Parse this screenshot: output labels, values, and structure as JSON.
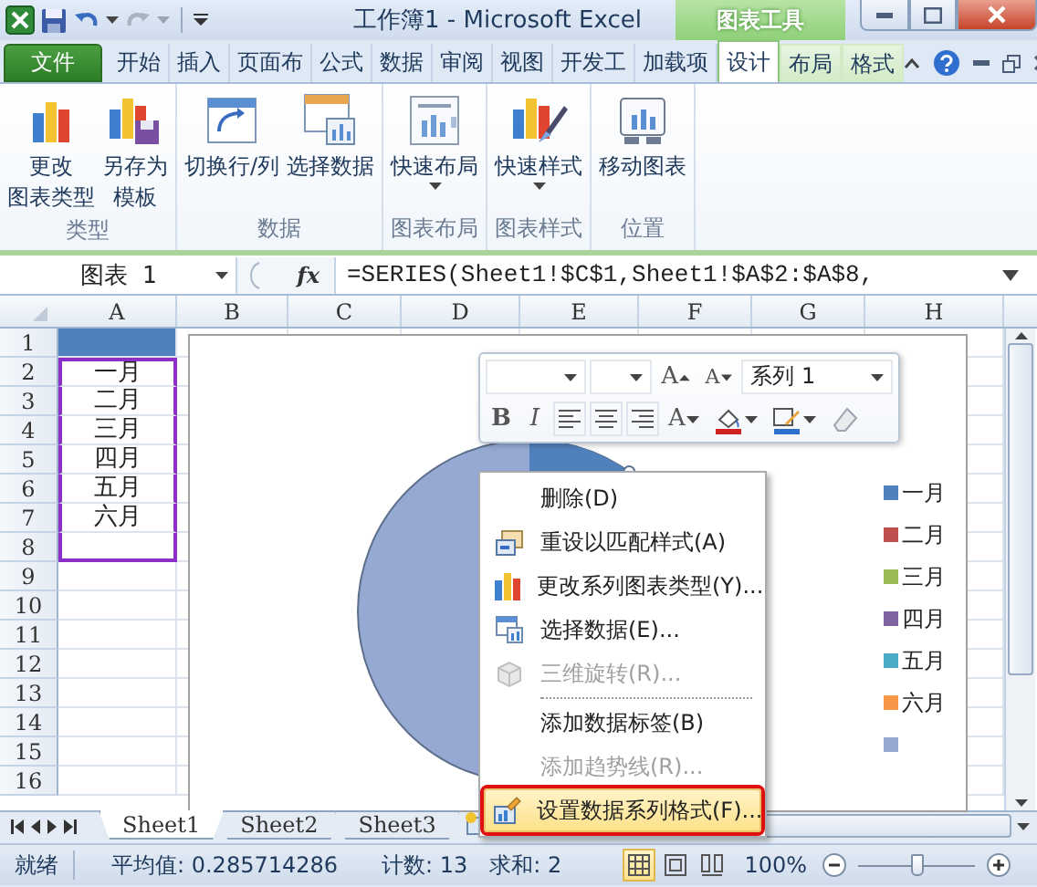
{
  "window": {
    "title": "工作簿1 - Microsoft Excel",
    "tool_group": "图表工具"
  },
  "ribbon_tabs": [
    {
      "label": "文件",
      "kind": "file",
      "selected": false
    },
    {
      "label": "开始",
      "kind": "normal",
      "selected": false
    },
    {
      "label": "插入",
      "kind": "normal",
      "selected": false
    },
    {
      "label": "页面布",
      "kind": "normal",
      "selected": false
    },
    {
      "label": "公式",
      "kind": "normal",
      "selected": false
    },
    {
      "label": "数据",
      "kind": "normal",
      "selected": false
    },
    {
      "label": "审阅",
      "kind": "normal",
      "selected": false
    },
    {
      "label": "视图",
      "kind": "normal",
      "selected": false
    },
    {
      "label": "开发工",
      "kind": "normal",
      "selected": false
    },
    {
      "label": "加载项",
      "kind": "normal",
      "selected": false
    },
    {
      "label": "设计",
      "kind": "context",
      "selected": true
    },
    {
      "label": "布局",
      "kind": "context",
      "selected": false
    },
    {
      "label": "格式",
      "kind": "context",
      "selected": false
    }
  ],
  "ribbon_groups": [
    {
      "label": "类型",
      "buttons": [
        {
          "lines": [
            "更改",
            "图表类型"
          ],
          "dropdown": false
        },
        {
          "lines": [
            "另存为",
            "模板"
          ],
          "dropdown": false
        }
      ]
    },
    {
      "label": "数据",
      "buttons": [
        {
          "lines": [
            "切换行/列"
          ],
          "dropdown": false
        },
        {
          "lines": [
            "选择数据"
          ],
          "dropdown": false
        }
      ]
    },
    {
      "label": "图表布局",
      "buttons": [
        {
          "lines": [
            "快速布局"
          ],
          "dropdown": true
        }
      ]
    },
    {
      "label": "图表样式",
      "buttons": [
        {
          "lines": [
            "快速样式"
          ],
          "dropdown": true
        }
      ]
    },
    {
      "label": "位置",
      "buttons": [
        {
          "lines": [
            "移动图表"
          ],
          "dropdown": false
        }
      ]
    }
  ],
  "formula_bar": {
    "name_box": "图表 1",
    "function_label": "fx",
    "formula": "=SERIES(Sheet1!$C$1,Sheet1!$A$2:$A$8,"
  },
  "columns": [
    "A",
    "B",
    "C",
    "D",
    "E",
    "F",
    "G",
    "H"
  ],
  "rows": [
    {
      "number": "1",
      "highlighted": true,
      "in_range": false
    },
    {
      "number": "2",
      "a": "一月",
      "highlighted": false,
      "in_range": true
    },
    {
      "number": "3",
      "a": "二月",
      "highlighted": false,
      "in_range": true
    },
    {
      "number": "4",
      "a": "三月",
      "highlighted": false,
      "in_range": true
    },
    {
      "number": "5",
      "a": "四月",
      "highlighted": false,
      "in_range": true
    },
    {
      "number": "6",
      "a": "五月",
      "highlighted": false,
      "in_range": true
    },
    {
      "number": "7",
      "a": "六月",
      "highlighted": false,
      "in_range": true
    },
    {
      "number": "8",
      "highlighted": false,
      "in_range": true
    },
    {
      "number": "9",
      "highlighted": false,
      "in_range": false
    },
    {
      "number": "10",
      "highlighted": false,
      "in_range": false
    },
    {
      "number": "11",
      "highlighted": false,
      "in_range": false
    },
    {
      "number": "12",
      "highlighted": false,
      "in_range": false
    },
    {
      "number": "13",
      "highlighted": false,
      "in_range": false
    },
    {
      "number": "14",
      "highlighted": false,
      "in_range": false
    },
    {
      "number": "15",
      "highlighted": false,
      "in_range": false
    },
    {
      "number": "16",
      "highlighted": false,
      "in_range": false
    }
  ],
  "chart": {
    "legend": [
      {
        "label": "一月",
        "color": "#4f81bd"
      },
      {
        "label": "二月",
        "color": "#c0504d"
      },
      {
        "label": "三月",
        "color": "#9bbb59"
      },
      {
        "label": "四月",
        "color": "#8064a2"
      },
      {
        "label": "五月",
        "color": "#4bacc6"
      },
      {
        "label": "六月",
        "color": "#f79646"
      },
      {
        "color": "#95a9d3"
      }
    ]
  },
  "mini_toolbar": {
    "series": "系列 1",
    "grow_font": "A",
    "shrink_font": "A",
    "bold": "B",
    "italic": "I",
    "font_color": "A"
  },
  "context_menu": [
    {
      "label": "删除(D)",
      "disabled": false,
      "selected": false,
      "annotated": false,
      "separator_before": false
    },
    {
      "label": "重设以匹配样式(A)",
      "disabled": false,
      "selected": false,
      "annotated": false,
      "separator_before": false
    },
    {
      "label": "更改系列图表类型(Y)...",
      "disabled": false,
      "selected": false,
      "annotated": false,
      "separator_before": false
    },
    {
      "label": "选择数据(E)...",
      "disabled": false,
      "selected": false,
      "annotated": false,
      "separator_before": false
    },
    {
      "label": "三维旋转(R)...",
      "disabled": true,
      "selected": false,
      "annotated": false,
      "separator_before": false
    },
    {
      "label": "添加数据标签(B)",
      "disabled": false,
      "selected": false,
      "annotated": false,
      "separator_before": true
    },
    {
      "label": "添加趋势线(R)...",
      "disabled": true,
      "selected": false,
      "annotated": false,
      "separator_before": false
    },
    {
      "label": "设置数据系列格式(F)...",
      "disabled": false,
      "selected": true,
      "annotated": true,
      "separator_before": false
    }
  ],
  "sheet_tabs": [
    {
      "label": "Sheet1",
      "selected": true
    },
    {
      "label": "Sheet2",
      "selected": false
    },
    {
      "label": "Sheet3",
      "selected": false
    }
  ],
  "status_bar": {
    "state": "就绪",
    "average": "平均值: 0.285714286",
    "count": "计数: 13",
    "sum": "求和: 2",
    "views": [
      {
        "selected": true
      },
      {
        "selected": false
      },
      {
        "selected": false
      }
    ],
    "zoom": "100%",
    "zoom_slider": {
      "level": 0.5
    }
  }
}
